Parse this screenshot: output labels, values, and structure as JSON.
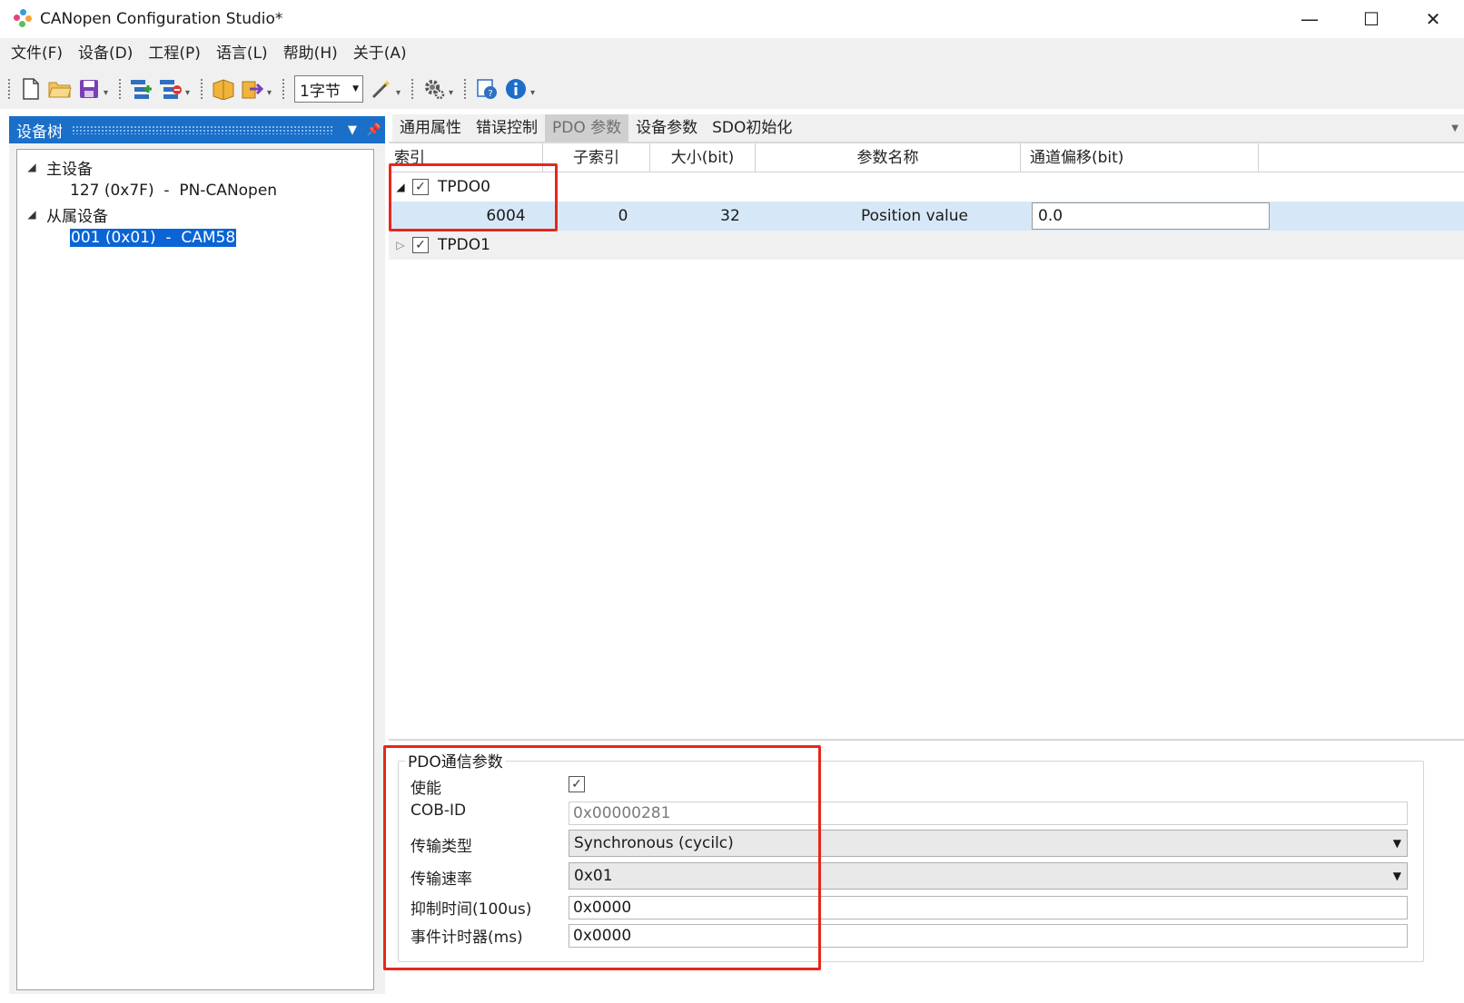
{
  "window": {
    "title": "CANopen Configuration Studio*",
    "controls": {
      "minimize": "—",
      "maximize": "☐",
      "close": "✕"
    }
  },
  "menu": [
    "文件(F)",
    "设备(D)",
    "工程(P)",
    "语言(L)",
    "帮助(H)",
    "关于(A)"
  ],
  "toolbar": {
    "byte_combo": "1字节",
    "icons": [
      "new-file-icon",
      "open-folder-icon",
      "save-icon",
      "add-device-icon",
      "remove-device-icon",
      "import-icon",
      "export-icon",
      "magic-wand-icon",
      "settings-gear-icon",
      "help-icon",
      "info-icon"
    ]
  },
  "device_tree": {
    "panel_title": "设备树",
    "nodes": [
      {
        "label": "主设备",
        "expanded": true
      },
      {
        "label": "127 (0x7F)  -  PN-CANopen"
      },
      {
        "label": "从属设备",
        "expanded": true
      },
      {
        "label": "001 (0x01)  -  CAM58",
        "selected": true
      }
    ]
  },
  "tabs": [
    "通用属性",
    "错误控制",
    "PDO 参数",
    "设备参数",
    "SDO初始化"
  ],
  "active_tab": "PDO 参数",
  "pdo_grid": {
    "columns": [
      "索引",
      "子索引",
      "大小(bit)",
      "参数名称",
      "通道偏移(bit)"
    ],
    "groups": [
      {
        "name": "TPDO0",
        "checked": true,
        "expanded": true,
        "rows": [
          {
            "index": "6004",
            "subindex": "0",
            "size": "32",
            "name": "Position value",
            "offset": "0.0"
          }
        ]
      },
      {
        "name": "TPDO1",
        "checked": true,
        "expanded": false,
        "rows": []
      }
    ]
  },
  "pdo_comm": {
    "title": "PDO通信参数",
    "enable_label": "使能",
    "enabled": true,
    "cob_id_label": "COB-ID",
    "cob_id": "0x00000281",
    "tx_type_label": "传输类型",
    "tx_type": "Synchronous (cycilc)",
    "tx_rate_label": "传输速率",
    "tx_rate": "0x01",
    "inhibit_label": "抑制时间(100us)",
    "inhibit": "0x0000",
    "event_timer_label": "事件计时器(ms)",
    "event_timer": "0x0000"
  },
  "colors": {
    "selection": "#0a64d6",
    "panel_header": "#1a6fc9",
    "highlight_box": "#e8261c",
    "row_selected": "#d6e8f7"
  }
}
